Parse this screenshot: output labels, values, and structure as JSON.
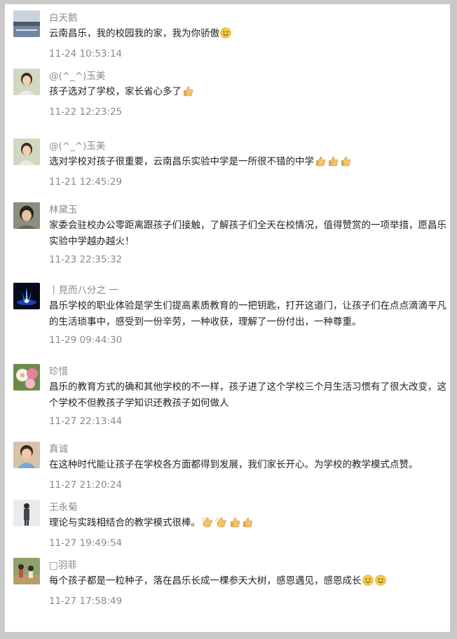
{
  "comments": [
    {
      "name": "白天鹅",
      "text": "云南昌乐，我的校园我的家，我为你骄傲",
      "emojis": [
        "smile-emoji"
      ],
      "time": "11-24 10:53:14",
      "avatar": "lake-scene-avatar"
    },
    {
      "name": "@(^_^)玉美",
      "text": "孩子选对了学校，家长省心多了",
      "emojis": [
        "thumbs-up-emoji"
      ],
      "time": "11-22 12:23:25",
      "avatar": "woman-portrait-avatar"
    },
    {
      "name": "@(^_^)玉美",
      "text": "选对学校对孩子很重要，云南昌乐实验中学是一所很不错的中学",
      "emojis": [
        "thumbs-up-emoji",
        "thumbs-up-emoji",
        "thumbs-up-emoji"
      ],
      "time": "11-21 12:45:29",
      "avatar": "woman-portrait-avatar"
    },
    {
      "name": "林黛玉",
      "text": "家委会驻校办公零距离跟孩子们接触，了解孩子们全天在校情况，值得赞赏的一项举措，愿昌乐实验中学越办越火！",
      "emojis": [],
      "time": "11-23 22:35:32",
      "avatar": "girl-portrait-avatar"
    },
    {
      "name": "丨見而八分之 一",
      "text": "昌乐学校的职业体验是学生们提高素质教育的一把钥匙，打开这道门，让孩子们在点点滴滴平凡的生活琐事中，感受到一份辛劳，一种收获，理解了一份付出，一种尊重。",
      "emojis": [],
      "time": "11-29 09:44:30",
      "avatar": "night-fountain-avatar"
    },
    {
      "name": "珍惜",
      "text": "昌乐的教育方式的确和其他学校的不一样，孩子进了这个学校三个月生活习惯有了很大改变，这个学校不但教孩子学知识还教孩子如何做人",
      "emojis": [],
      "time": "11-27 22:13:44",
      "avatar": "flowers-avatar"
    },
    {
      "name": "真诚",
      "text": "在这种时代能让孩子在学校各方面都得到发展，我们家长开心。为学校的教学模式点赞。",
      "emojis": [],
      "time": "11-27 21:20:24",
      "avatar": "baby-avatar"
    },
    {
      "name": "王永菊",
      "text": "理论与实践相结合的教学模式很棒。",
      "emojis": [
        "clap-emoji",
        "clap-emoji",
        "thumbs-up-emoji",
        "thumbs-up-emoji"
      ],
      "time": "11-27 19:49:54",
      "avatar": "standing-woman-avatar"
    },
    {
      "name": "□羽菲",
      "text": "每个孩子都是一粒种子，落在昌乐长成一棵参天大树，感恩遇见，感恩成长",
      "emojis": [
        "smile-emoji",
        "smile-emoji"
      ],
      "time": "11-27 17:58:49",
      "avatar": "family-outdoor-avatar"
    }
  ]
}
